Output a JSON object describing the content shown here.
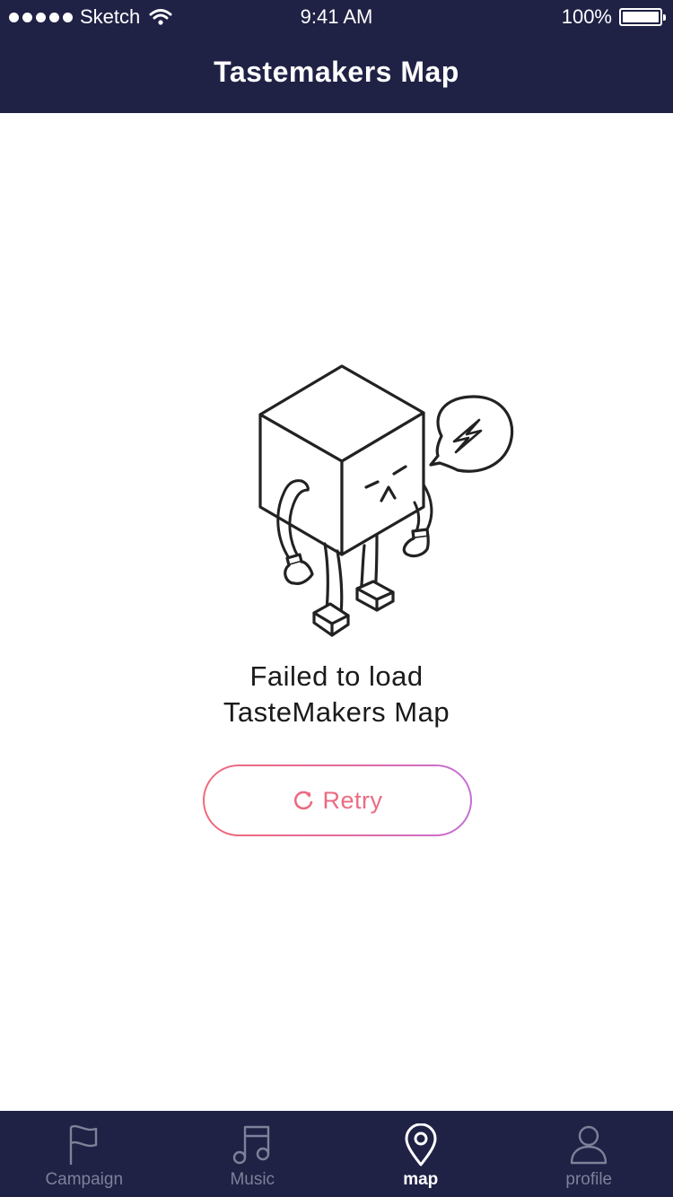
{
  "status_bar": {
    "carrier": "Sketch",
    "time": "9:41 AM",
    "battery": "100%"
  },
  "header": {
    "title": "Tastemakers Map"
  },
  "illustration": {
    "icon": "broken-box-robot-illustration"
  },
  "error": {
    "line1": "Failed to load",
    "line2": "TasteMakers Map"
  },
  "retry_button": {
    "label": "Retry",
    "icon": "refresh-icon"
  },
  "tabbar": {
    "tabs": [
      {
        "label": "Campaign",
        "icon": "flag-icon",
        "active": false
      },
      {
        "label": "Music",
        "icon": "music-note-icon",
        "active": false
      },
      {
        "label": "map",
        "icon": "map-pin-icon",
        "active": true
      },
      {
        "label": "profile",
        "icon": "person-icon",
        "active": false
      }
    ]
  },
  "colors": {
    "nav_background": "#1f2145",
    "retry_gradient_start": "#f06a7a",
    "retry_gradient_end": "#c56fd6",
    "inactive_tab": "#7f8199"
  }
}
